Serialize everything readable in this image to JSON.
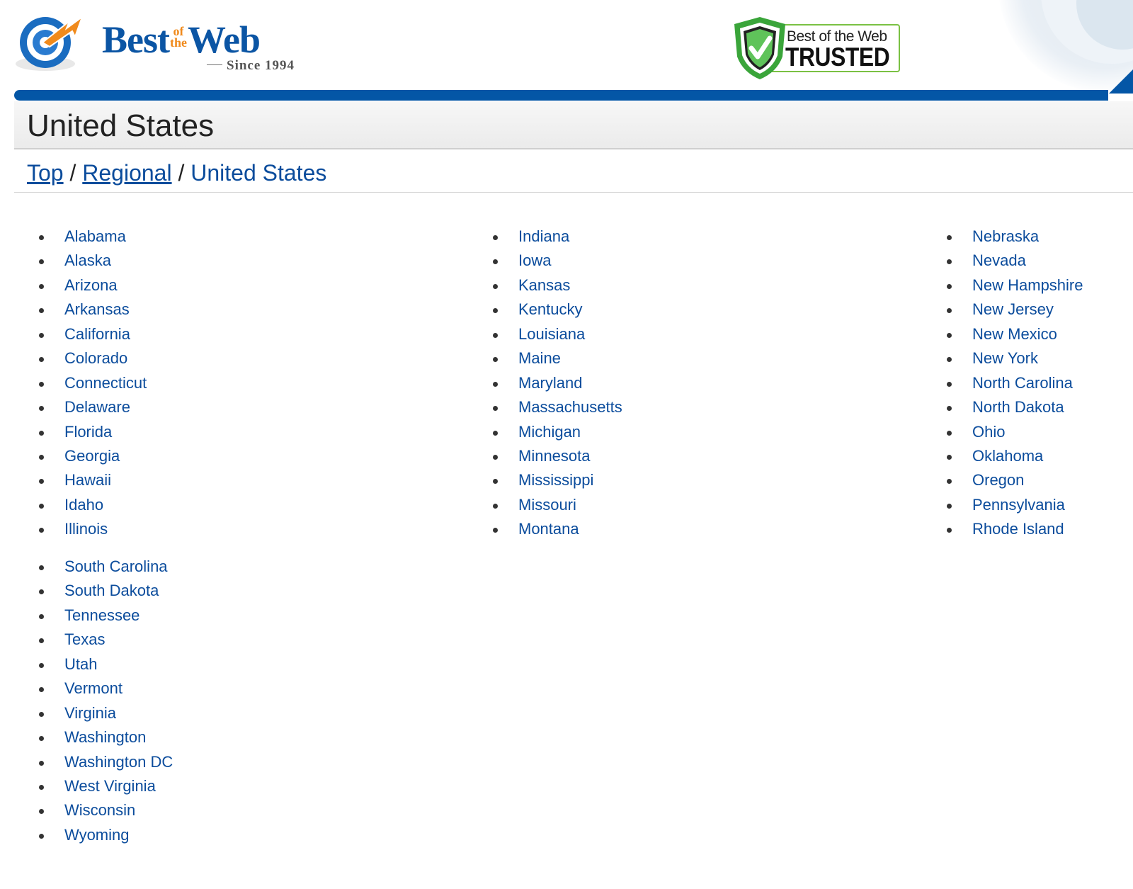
{
  "header": {
    "logo": {
      "word_best": "Best",
      "word_of": "of",
      "word_the": "the",
      "word_web": "Web",
      "tagline": "Since 1994",
      "icon": "target-arrow-icon"
    },
    "trust_badge": {
      "line1": "Best of the Web",
      "line2": "TRUSTED",
      "icon": "shield-check-icon"
    },
    "colors": {
      "brand_blue": "#0456a6",
      "brand_orange": "#f08a1c",
      "link_blue": "#0b4c9c",
      "badge_green": "#7ac143"
    }
  },
  "page": {
    "title": "United States"
  },
  "breadcrumb": {
    "items": [
      {
        "label": "Top",
        "link": true
      },
      {
        "label": "Regional",
        "link": true
      },
      {
        "label": "United States",
        "link": false
      }
    ],
    "separator": "/"
  },
  "states": {
    "column1": [
      "Alabama",
      "Alaska",
      "Arizona",
      "Arkansas",
      "California",
      "Colorado",
      "Connecticut",
      "Delaware",
      "Florida",
      "Georgia",
      "Hawaii",
      "Idaho",
      "Illinois"
    ],
    "column2": [
      "Indiana",
      "Iowa",
      "Kansas",
      "Kentucky",
      "Louisiana",
      "Maine",
      "Maryland",
      "Massachusetts",
      "Michigan",
      "Minnesota",
      "Mississippi",
      "Missouri",
      "Montana"
    ],
    "column3": [
      "Nebraska",
      "Nevada",
      "New Hampshire",
      "New Jersey",
      "New Mexico",
      "New York",
      "North Carolina",
      "North Dakota",
      "Ohio",
      "Oklahoma",
      "Oregon",
      "Pennsylvania",
      "Rhode Island"
    ],
    "column4": [
      "South Carolina",
      "South Dakota",
      "Tennessee",
      "Texas",
      "Utah",
      "Vermont",
      "Virginia",
      "Washington",
      "Washington DC",
      "West Virginia",
      "Wisconsin",
      "Wyoming"
    ]
  }
}
